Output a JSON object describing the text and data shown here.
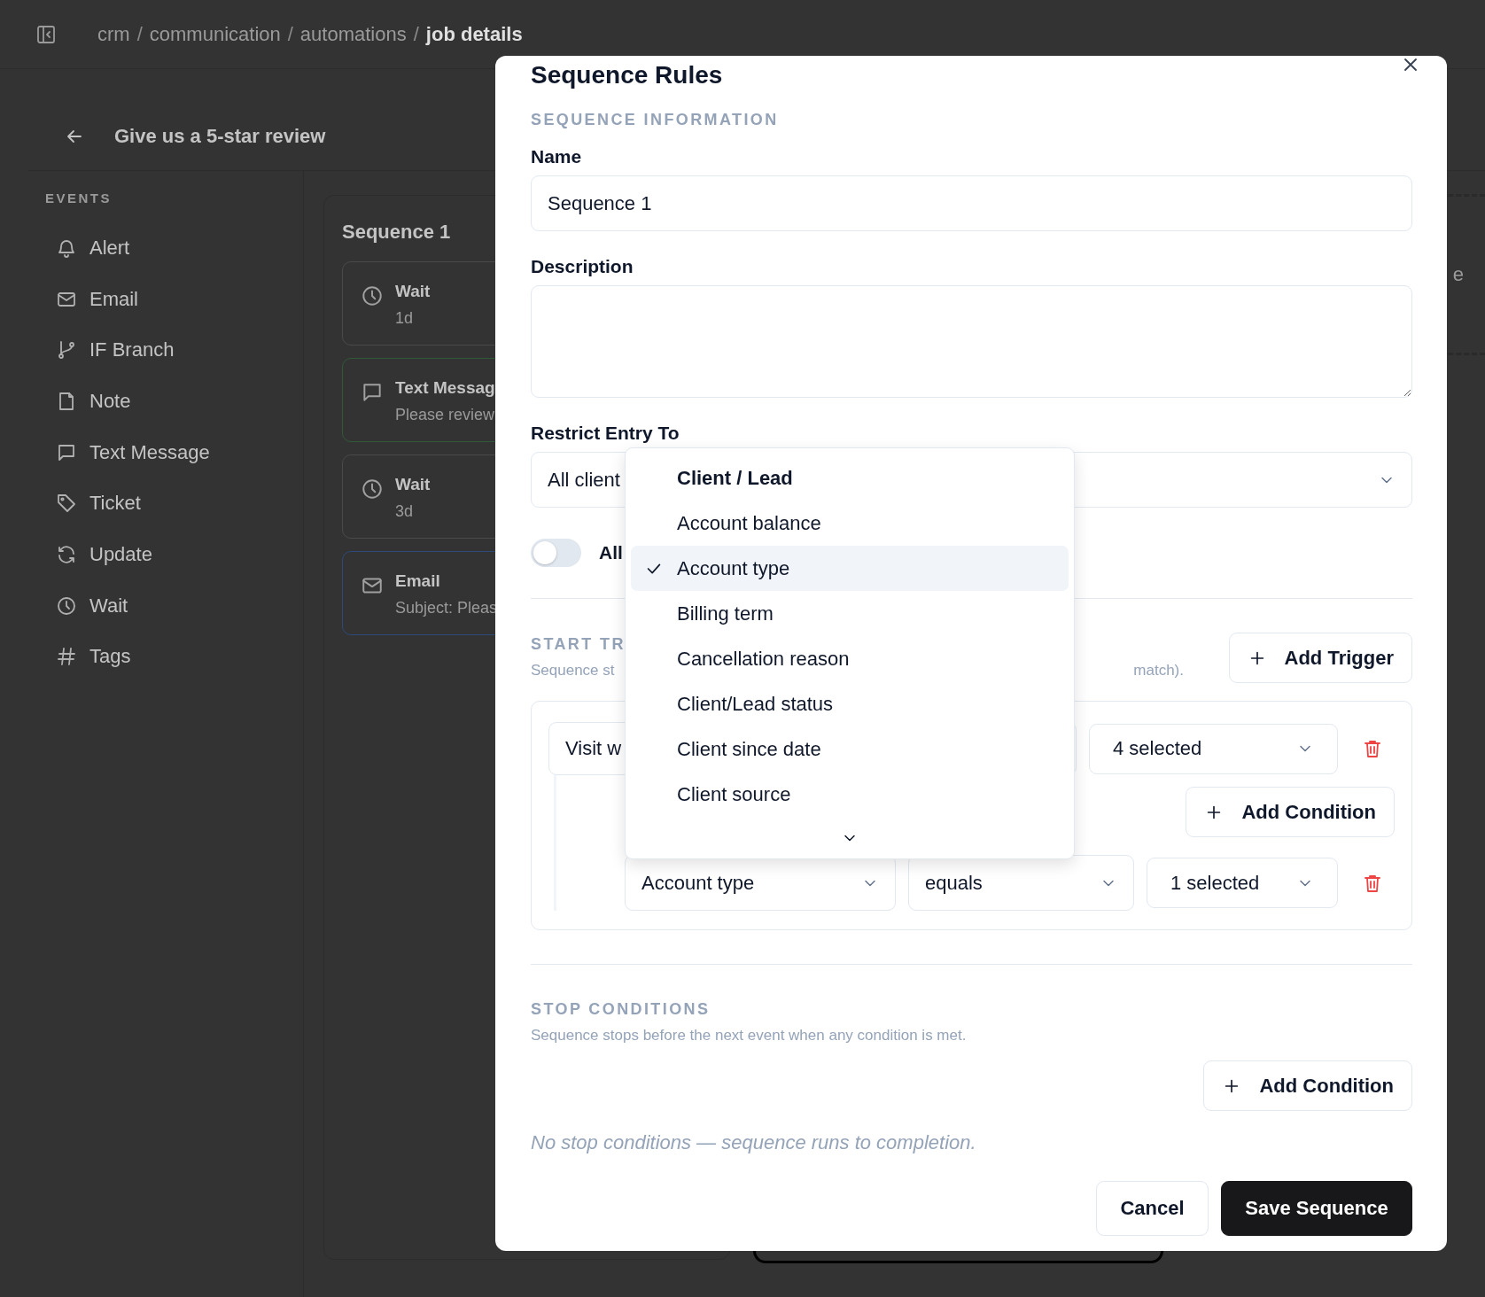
{
  "app": {
    "breadcrumb": [
      {
        "kind": "link",
        "label": "crm",
        "current": false
      },
      {
        "kind": "separator",
        "label": "/"
      },
      {
        "kind": "link",
        "label": "communication",
        "current": false
      },
      {
        "kind": "separator",
        "label": "/"
      },
      {
        "kind": "link",
        "label": "automations",
        "current": false
      },
      {
        "kind": "separator",
        "label": "/"
      },
      {
        "kind": "link",
        "label": "job details",
        "current": true
      }
    ],
    "header": {
      "title": "Give us a 5-star review"
    },
    "sidebar": {
      "heading": "EVENTS",
      "items": [
        {
          "kind": "alert",
          "label": "Alert"
        },
        {
          "kind": "email",
          "label": "Email"
        },
        {
          "kind": "branch",
          "label": "IF Branch"
        },
        {
          "kind": "note",
          "label": "Note"
        },
        {
          "kind": "message",
          "label": "Text Message"
        },
        {
          "kind": "ticket",
          "label": "Ticket"
        },
        {
          "kind": "update",
          "label": "Update"
        },
        {
          "kind": "wait",
          "label": "Wait"
        },
        {
          "kind": "tags",
          "label": "Tags"
        }
      ]
    },
    "sequence": {
      "title": "Sequence 1",
      "events": [
        {
          "kind": "wait",
          "title": "Wait",
          "detail": "1d",
          "color": "#4a4a4a"
        },
        {
          "kind": "message",
          "title": "Text Messag",
          "detail": "Please review",
          "color": "#2f5a3a"
        },
        {
          "kind": "wait",
          "title": "Wait",
          "detail": "3d",
          "color": "#4a4a4a"
        },
        {
          "kind": "email",
          "title": "Email",
          "detail": "Subject: Pleas",
          "color": "#2c4a7a"
        }
      ]
    },
    "side_text": "e"
  },
  "modal": {
    "title": "Sequence Rules",
    "info_heading": "SEQUENCE INFORMATION",
    "name": {
      "label": "Name",
      "value": "Sequence 1"
    },
    "description": {
      "label": "Description"
    },
    "restrict": {
      "label": "Restrict Entry To",
      "value": "All client"
    },
    "allow_toggle": {
      "label": "All",
      "on": false
    },
    "start": {
      "heading": "START TR",
      "text_left": "Sequence st",
      "text_right": "match).",
      "add_button": "Add Trigger",
      "trigger": {
        "field": "Visit w",
        "selection": "4 selected",
        "add_condition": "Add Condition",
        "conditions": [
          {
            "field": "Account type",
            "operator": "equals",
            "selection": "1 selected"
          }
        ]
      }
    },
    "stop": {
      "heading": "STOP CONDITIONS",
      "text": "Sequence stops before the next event when any condition is met.",
      "add_button": "Add Condition",
      "empty": "No stop conditions — sequence runs to completion."
    },
    "buttons": [
      {
        "kind": "secondary",
        "label": "Cancel"
      },
      {
        "kind": "primary",
        "label": "Save Sequence"
      }
    ]
  },
  "dropdown": {
    "group": "Client / Lead",
    "options": [
      {
        "label": "Account balance",
        "selected": false
      },
      {
        "label": "Account type",
        "selected": true
      },
      {
        "label": "Billing term",
        "selected": false
      },
      {
        "label": "Cancellation reason",
        "selected": false
      },
      {
        "label": "Client/Lead status",
        "selected": false
      },
      {
        "label": "Client since date",
        "selected": false
      },
      {
        "label": "Client source",
        "selected": false
      }
    ]
  }
}
